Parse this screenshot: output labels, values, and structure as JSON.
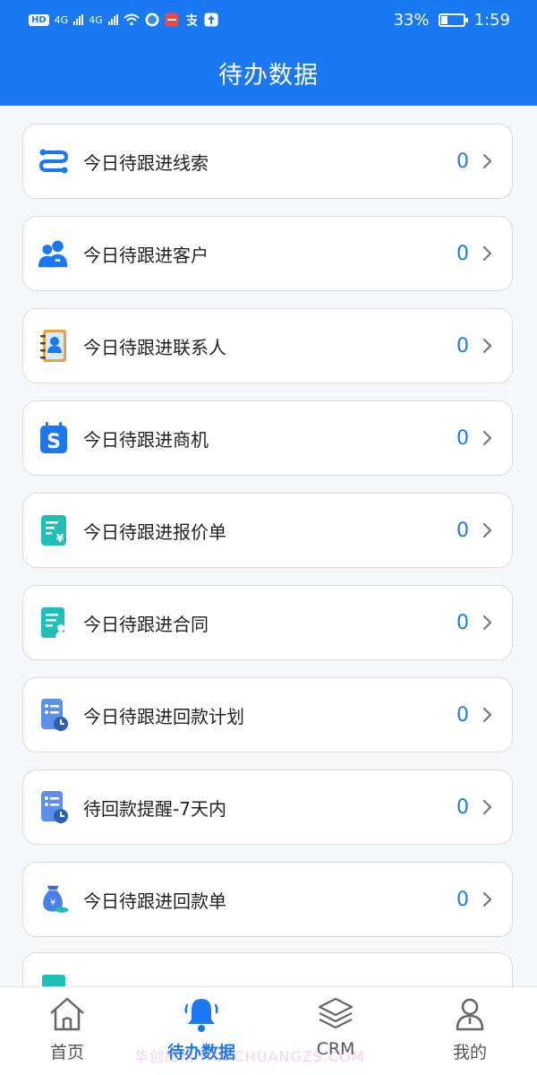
{
  "status_bar": {
    "network_badge": "HD",
    "sim1": "4G",
    "sim2": "4G",
    "battery_percent": "33%",
    "battery_level": 0.33,
    "time": "1:59"
  },
  "header": {
    "title": "待办数据"
  },
  "items": [
    {
      "label": "今日待跟进线索",
      "count": "0",
      "icon": "route-icon"
    },
    {
      "label": "今日待跟进客户",
      "count": "0",
      "icon": "customer-group-icon"
    },
    {
      "label": "今日待跟进联系人",
      "count": "0",
      "icon": "contact-book-icon"
    },
    {
      "label": "今日待跟进商机",
      "count": "0",
      "icon": "opportunity-icon"
    },
    {
      "label": "今日待跟进报价单",
      "count": "0",
      "icon": "quote-icon"
    },
    {
      "label": "今日待跟进合同",
      "count": "0",
      "icon": "contract-icon"
    },
    {
      "label": "今日待跟进回款计划",
      "count": "0",
      "icon": "payment-plan-icon"
    },
    {
      "label": "待回款提醒-7天内",
      "count": "0",
      "icon": "payment-reminder-icon"
    },
    {
      "label": "今日待跟进回款单",
      "count": "0",
      "icon": "money-bag-icon"
    }
  ],
  "bottom_nav": [
    {
      "label": "首页",
      "icon": "home-icon",
      "active": false
    },
    {
      "label": "待办数据",
      "icon": "bell-icon",
      "active": true
    },
    {
      "label": "CRM",
      "icon": "layers-icon",
      "active": false
    },
    {
      "label": "我的",
      "icon": "user-icon",
      "active": false
    }
  ],
  "watermark": "华创应用 HUACHUANGZS.COM",
  "colors": {
    "primary": "#1a78f2",
    "count": "#1a7ae6",
    "teal": "#1fbfb8"
  }
}
